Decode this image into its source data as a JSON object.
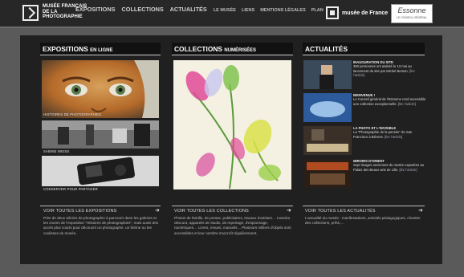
{
  "header": {
    "logo_text": "MUSÉE FRANÇAIS DE LA PHOTOGRAPHIE",
    "nav_main": [
      "EXPOSITIONS",
      "COLLECTIONS",
      "ACTUALITÉS"
    ],
    "nav_secondary": [
      "LE MUSÉE",
      "LIENS",
      "MENTIONS LÉGALES",
      "PLAN"
    ],
    "brand_label": "musée de France",
    "essonne_label": "Essonne",
    "essonne_sub": "LE CONSEIL GÉNÉRAL"
  },
  "columns": {
    "expositions": {
      "title": "EXPOSITIONS",
      "title_small": "EN LIGNE",
      "items": [
        "HISTOIRES DE PHOTOGRAPHIES",
        "SABINE WEISS",
        "CONSERVER POUR PARTAGER"
      ],
      "link": "VOIR TOUTES LES EXPOSITIONS",
      "desc": "Près de deux siècles de photographie à parcourir dans les galeries et les zooms de l'exposition \"Histoires de photographies\", mais aussi des accès plus courts pour découvrir un photographe, un thème ou les coulisses du musée."
    },
    "collections": {
      "title": "COLLECTIONS",
      "title_small": "NUMÉRISÉES",
      "link": "VOIR TOUTES LES COLLECTIONS",
      "desc": "Photos de famille, de presse, publicitaires, travaux d'artistes… Caméra obscura, appareils de studio, de reportage, d'espionnage, numériques… Livres, revues, manuels… Plusieurs milliers d'objets sont accessibles et leur nombre s'accroît régulièrement."
    },
    "actualites": {
      "title": "ACTUALITÉS",
      "items": [
        {
          "head": "INAUGURATION DU SITE",
          "body": "360 personnes ont assisté le 13 mai au lancement du site par Michel Berson.",
          "link": "[lire l'article]"
        },
        {
          "head": "BIENVENUE !",
          "body": "Le Conseil général de l'Essonne rend accessible une collection exceptionnelle.",
          "link": "[lire l'article]"
        },
        {
          "head": "LA PHOTO ET L'INVISIBLE",
          "body": "La \"Photographie de la pensée\" de San Francisco à Bièvres.",
          "link": "[lire l'article]"
        },
        {
          "head": "MIROIRS D'ORIENT",
          "body": "Sept images anciennes du musée exposées au Palais des Beaux-arts de Lille.",
          "link": "[lire l'article]"
        }
      ],
      "link": "VOIR TOUTES LES ACTUALITÉS",
      "desc": "L'actualité du musée : manifestations, activités pédagogiques, chantier des collections, prêts,…"
    }
  },
  "colors": {
    "bg": "#5a5a5a",
    "panel": "#202020",
    "header": "#272727"
  }
}
